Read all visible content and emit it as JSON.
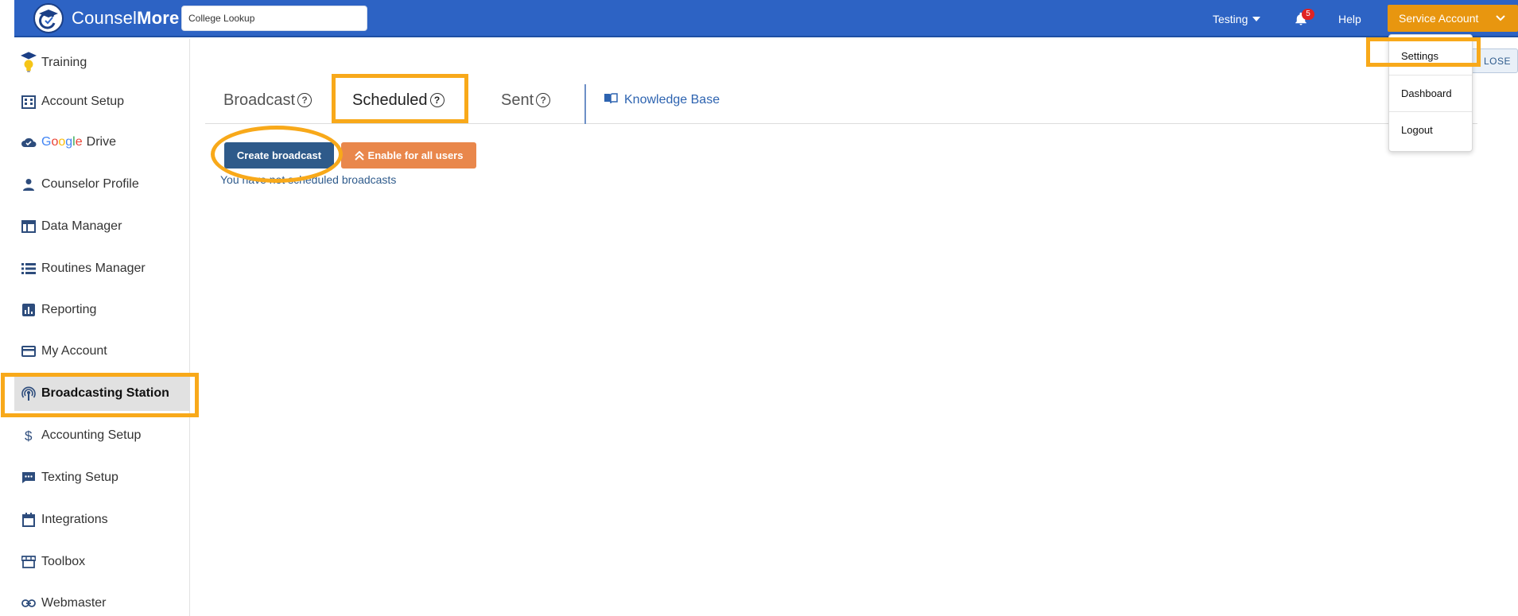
{
  "header": {
    "brand_light": "Counsel",
    "brand_bold": "More",
    "search_value": "College Lookup",
    "testing_label": "Testing",
    "notification_count": "5",
    "help_label": "Help",
    "account_label": "Service Account"
  },
  "account_menu": {
    "items": [
      {
        "label": "Settings"
      },
      {
        "label": "Dashboard"
      },
      {
        "label": "Logout"
      }
    ]
  },
  "sidebar": {
    "google_letters": [
      "G",
      "o",
      "o",
      "g",
      "l",
      "e"
    ],
    "google_colors": [
      "#4285f4",
      "#ea4335",
      "#fbbc05",
      "#4285f4",
      "#34a853",
      "#ea4335"
    ],
    "items": [
      {
        "label": "Training",
        "icon": "lightbulb-graduation-icon"
      },
      {
        "label": "Account Setup",
        "icon": "building-icon"
      },
      {
        "label": "Drive",
        "icon": "cloud-check-icon"
      },
      {
        "label": "Counselor Profile",
        "icon": "person-icon"
      },
      {
        "label": "Data Manager",
        "icon": "table-icon"
      },
      {
        "label": "Routines Manager",
        "icon": "list-icon"
      },
      {
        "label": "Reporting",
        "icon": "bar-chart-icon"
      },
      {
        "label": "My Account",
        "icon": "credit-card-icon"
      },
      {
        "label": "Broadcasting Station",
        "icon": "broadcast-tower-icon",
        "active": true
      },
      {
        "label": "Accounting Setup",
        "icon": "dollar-icon"
      },
      {
        "label": "Texting Setup",
        "icon": "chat-icon"
      },
      {
        "label": "Integrations",
        "icon": "calendar-icon"
      },
      {
        "label": "Toolbox",
        "icon": "storefront-icon"
      },
      {
        "label": "Webmaster",
        "icon": "link-icon"
      }
    ]
  },
  "main": {
    "tabs": [
      {
        "label": "Broadcast"
      },
      {
        "label": "Scheduled",
        "active": true
      },
      {
        "label": "Sent"
      }
    ],
    "help_glyph": "?",
    "knowledge_base_label": "Knowledge Base",
    "create_button_label": "Create broadcast",
    "enable_button_label": "Enable for all users",
    "status_text": "You have not scheduled broadcasts",
    "close_label": "LOSE"
  },
  "colors": {
    "header_bg": "#2d63c4",
    "account_button": "#e8960f",
    "create_button": "#2e5a8a",
    "enable_button": "#e9874b",
    "highlight": "#f8a91a"
  }
}
